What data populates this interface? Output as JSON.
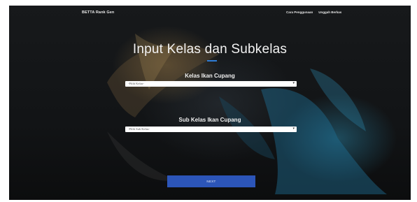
{
  "nav": {
    "brand": "BETTA Rank Gen",
    "links": [
      "Cara Penggunaan",
      "Unggah Berkas"
    ]
  },
  "title": "Input Kelas dan Subkelas",
  "class_field": {
    "label": "Kelas Ikan Cupang",
    "value": "-Pilih Kelas-"
  },
  "subclass_field": {
    "label": "Sub Kelas Ikan Cupang",
    "value": "-Pilih Sub Kelas-"
  },
  "submit_label": "NEXT",
  "colors": {
    "accent": "#2f7dd6",
    "button": "#2c55b8",
    "background": "#141618"
  }
}
